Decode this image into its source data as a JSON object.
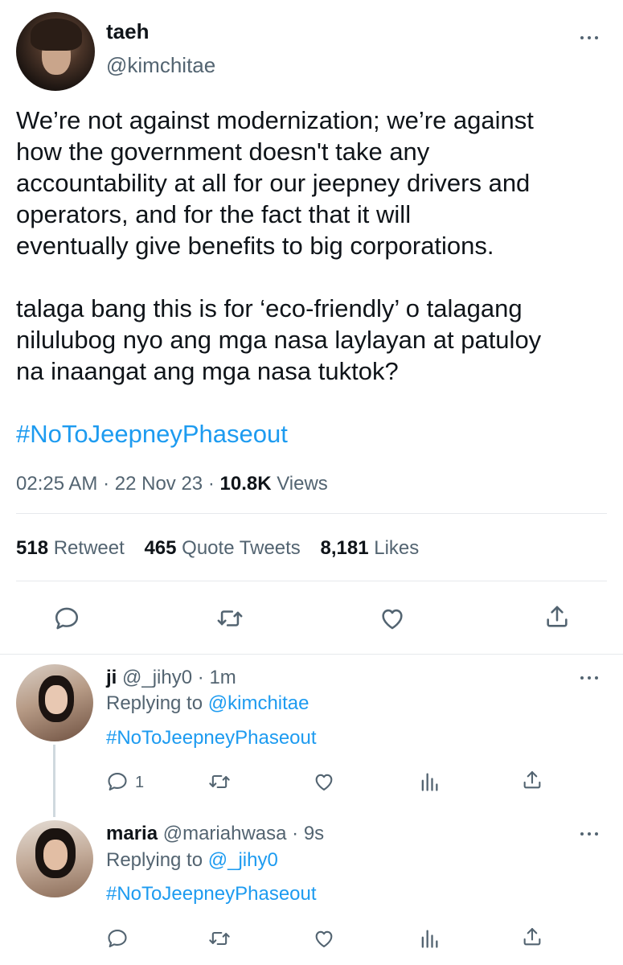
{
  "main_tweet": {
    "author_name": "taeh",
    "author_handle": "@kimchitae",
    "paragraph1_lines": [
      "We’re not against modernization; we’re against",
      "how the government doesn't take any",
      "accountability at all for our jeepney drivers and",
      "operators, and for the fact that it will",
      "eventually give benefits to big corporations."
    ],
    "paragraph2_lines": [
      "talaga bang this is for ‘eco-friendly’ o talagang",
      "nilulubog nyo ang mga nasa laylayan at patuloy",
      "na inaangat ang mga nasa tuktok?"
    ],
    "hashtag": "#NoToJeepneyPhaseout",
    "time": "02:25 AM",
    "date": "22 Nov 23",
    "views_count": "10.8K",
    "views_label": "Views",
    "sep": "·",
    "retweets_count": "518",
    "retweets_label": "Retweet",
    "quotes_count": "465",
    "quotes_label": "Quote Tweets",
    "likes_count": "8,181",
    "likes_label": "Likes"
  },
  "replies": [
    {
      "name": "ji",
      "handle": "@_jihy0",
      "time": "1m",
      "sep": "·",
      "replying_label": "Replying to",
      "replying_to": "@kimchitae",
      "hashtag": "#NoToJeepneyPhaseout",
      "reply_count": "1"
    },
    {
      "name": "maria",
      "handle": "@mariahwasa",
      "time": "9s",
      "sep": "·",
      "replying_label": "Replying to",
      "replying_to": "@_jihy0",
      "hashtag": "#NoToJeepneyPhaseout",
      "reply_count": ""
    }
  ],
  "colors": {
    "link": "#1d9bf0",
    "secondary_text": "#536471",
    "primary_text": "#0f1419",
    "divider": "#e6e9ec"
  }
}
